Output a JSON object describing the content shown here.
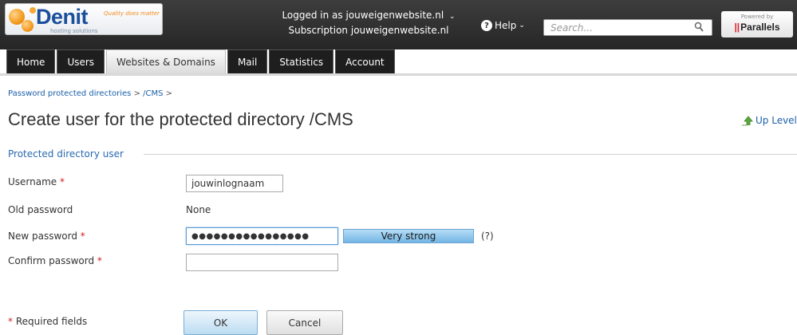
{
  "header": {
    "logo": {
      "name": "Denit",
      "tagline": "Quality does matter",
      "subtitle": "hosting solutions"
    },
    "login": {
      "logged_in_label": "Logged in as",
      "logged_in_value": "jouweigenwebsite.nl",
      "subscription_label": "Subscription",
      "subscription_value": "jouweigenwebsite.nl"
    },
    "help_label": "Help",
    "search_placeholder": "Search...",
    "powered_by": "Powered by",
    "powered_brand": "Parallels"
  },
  "tabs": [
    {
      "label": "Home",
      "active": false
    },
    {
      "label": "Users",
      "active": false
    },
    {
      "label": "Websites & Domains",
      "active": true
    },
    {
      "label": "Mail",
      "active": false
    },
    {
      "label": "Statistics",
      "active": false
    },
    {
      "label": "Account",
      "active": false
    }
  ],
  "breadcrumb": {
    "items": [
      "Password protected directories",
      "/CMS"
    ],
    "separator": ">"
  },
  "page_title": "Create user for the protected directory /CMS",
  "up_level_label": "Up Level",
  "section": {
    "legend": "Protected directory user"
  },
  "form": {
    "required_marker": "*",
    "username": {
      "label": "Username",
      "value": "jouwinlognaam"
    },
    "old_password": {
      "label": "Old password",
      "value": "None"
    },
    "new_password": {
      "label": "New password",
      "value": "●●●●●●●●●●●●●●●●"
    },
    "confirm_password": {
      "label": "Confirm password",
      "value": ""
    },
    "strength_label": "Very strong",
    "strength_help": "(?)"
  },
  "footer": {
    "required_note": "Required fields",
    "ok_label": "OK",
    "cancel_label": "Cancel"
  },
  "colors": {
    "header_bg": "#2e2e2e",
    "link": "#1a5fa8",
    "required": "#d42020",
    "strength_bar": "#74b6e6"
  }
}
